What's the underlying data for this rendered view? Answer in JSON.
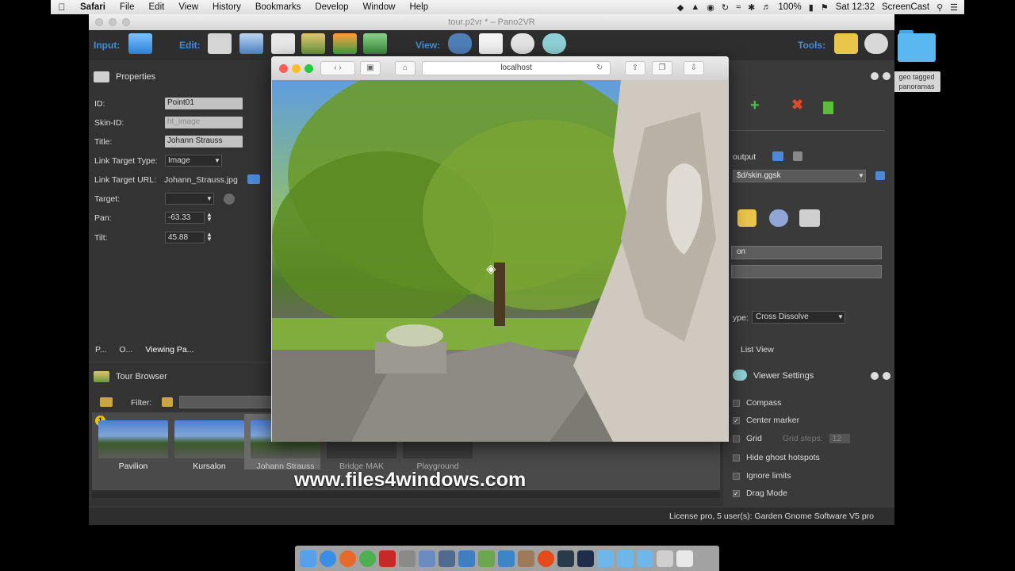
{
  "menubar": {
    "app": "Safari",
    "items": [
      "File",
      "Edit",
      "View",
      "History",
      "Bookmarks",
      "Develop",
      "Window",
      "Help"
    ],
    "battery": "100%",
    "clock": "Sat 12:32",
    "app_right": "ScreenCast"
  },
  "window": {
    "title": "tour.p2vr * – Pano2VR"
  },
  "toolbar": {
    "input_label": "Input:",
    "edit_label": "Edit:",
    "view_label": "View:",
    "tools_label": "Tools:"
  },
  "properties": {
    "header": "Properties",
    "rows": [
      {
        "label": "ID:",
        "value": "Point01"
      },
      {
        "label": "Skin-ID:",
        "value": "ht_image"
      },
      {
        "label": "Title:",
        "value": "Johann Strauss"
      },
      {
        "label": "Link Target Type:",
        "value": "Image"
      },
      {
        "label": "Link Target URL:",
        "value": "Johann_Strauss.jpg"
      },
      {
        "label": "Target:",
        "value": ""
      },
      {
        "label": "Pan:",
        "value": "-63.33"
      },
      {
        "label": "Tilt:",
        "value": "45.88"
      }
    ]
  },
  "panel_tabs": [
    "P...",
    "O...",
    "Viewing Pa..."
  ],
  "tour_browser": {
    "header": "Tour Browser",
    "filter_label": "Filter:",
    "items": [
      "Pavilion",
      "Kursalon",
      "Johann Strauss",
      "Bridge MAK",
      "Playground"
    ],
    "selected": "Johann Strauss"
  },
  "right_panel": {
    "output_label": "output",
    "skin_path": "$d/skin.ggsk",
    "button1": "on",
    "transition_label": "ype:",
    "transition_value": "Cross Dissolve",
    "list_view": "List View",
    "viewer_settings_header": "Viewer Settings",
    "settings": [
      {
        "label": "Compass",
        "checked": false
      },
      {
        "label": "Center marker",
        "checked": true
      },
      {
        "label": "Grid",
        "checked": false
      },
      {
        "label": "Hide ghost hotspots",
        "checked": false
      },
      {
        "label": "Ignore limits",
        "checked": false
      },
      {
        "label": "Drag Mode",
        "checked": true
      }
    ],
    "grid_steps_label": "Grid steps:",
    "grid_steps_value": "12"
  },
  "desktop": {
    "folder_label": "geo tagged panoramas"
  },
  "safari": {
    "url": "localhost"
  },
  "status": {
    "license": "License pro, 5 user(s): Garden Gnome Software V5 pro"
  },
  "watermark": "www.files4windows.com",
  "colors": {
    "accent_blue": "#3c8fe0",
    "panel_bg": "#3a3a3a",
    "field_bg": "#c2c2c2"
  }
}
